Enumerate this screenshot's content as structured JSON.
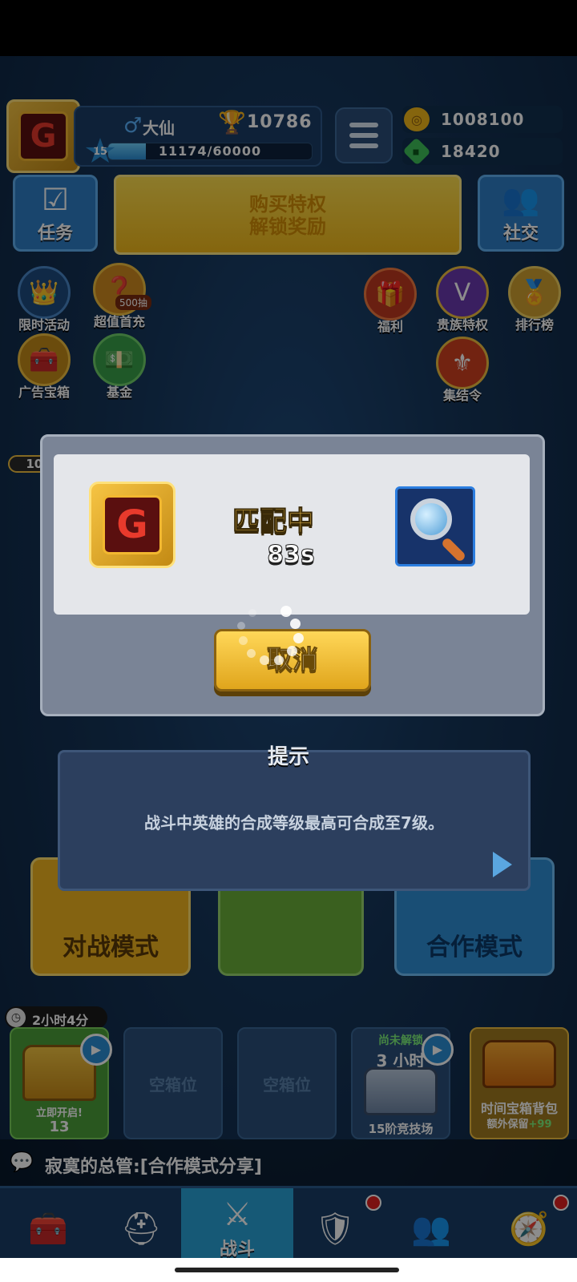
{
  "player": {
    "name": "大仙",
    "gender_symbol": "♂",
    "trophies": "10786",
    "level": "15",
    "xp_text": "11174/60000",
    "xp_fraction": 0.186
  },
  "currency": {
    "gold": "1008100",
    "gems": "18420"
  },
  "top_buttons": {
    "tasks": "任务",
    "banner_line1": "购买特权",
    "banner_line2": "解锁奖励",
    "social": "社交"
  },
  "left_icons": [
    {
      "label": "限时活动"
    },
    {
      "label": "超值首充",
      "badge": "500抽"
    },
    {
      "label": "广告宝箱"
    },
    {
      "label": "基金"
    }
  ],
  "ad_chest_count": "10/10",
  "right_icons": [
    {
      "label": "福利"
    },
    {
      "label": "贵族特权"
    },
    {
      "label": "排行榜"
    },
    {
      "label": "集结令"
    }
  ],
  "modes": {
    "left": "对战模式",
    "right": "合作模式"
  },
  "chests": {
    "timer": "2小时4分",
    "slot1_open": "立即开启!",
    "slot1_gems": "13",
    "empty_label": "空箱位",
    "locked_top": "尚未解锁",
    "locked_time": "3 小时",
    "arena_label": "15阶竞技场",
    "bag_title": "时间宝箱背包",
    "bag_sub": "额外保留",
    "bag_extra": "+99"
  },
  "chat": {
    "message": "寂寞的总管:[合作模式分享]"
  },
  "nav": {
    "battle": "战斗"
  },
  "match_dialog": {
    "status": "匹配中",
    "timer": "83s",
    "cancel": "取消"
  },
  "tip_dialog": {
    "title": "提示",
    "message": "战斗中英雄的合成等级最高可合成至7级。"
  },
  "colors": {
    "accent_gold": "#f2b91a",
    "nav_active": "#29a3d8",
    "background": "#153559"
  }
}
